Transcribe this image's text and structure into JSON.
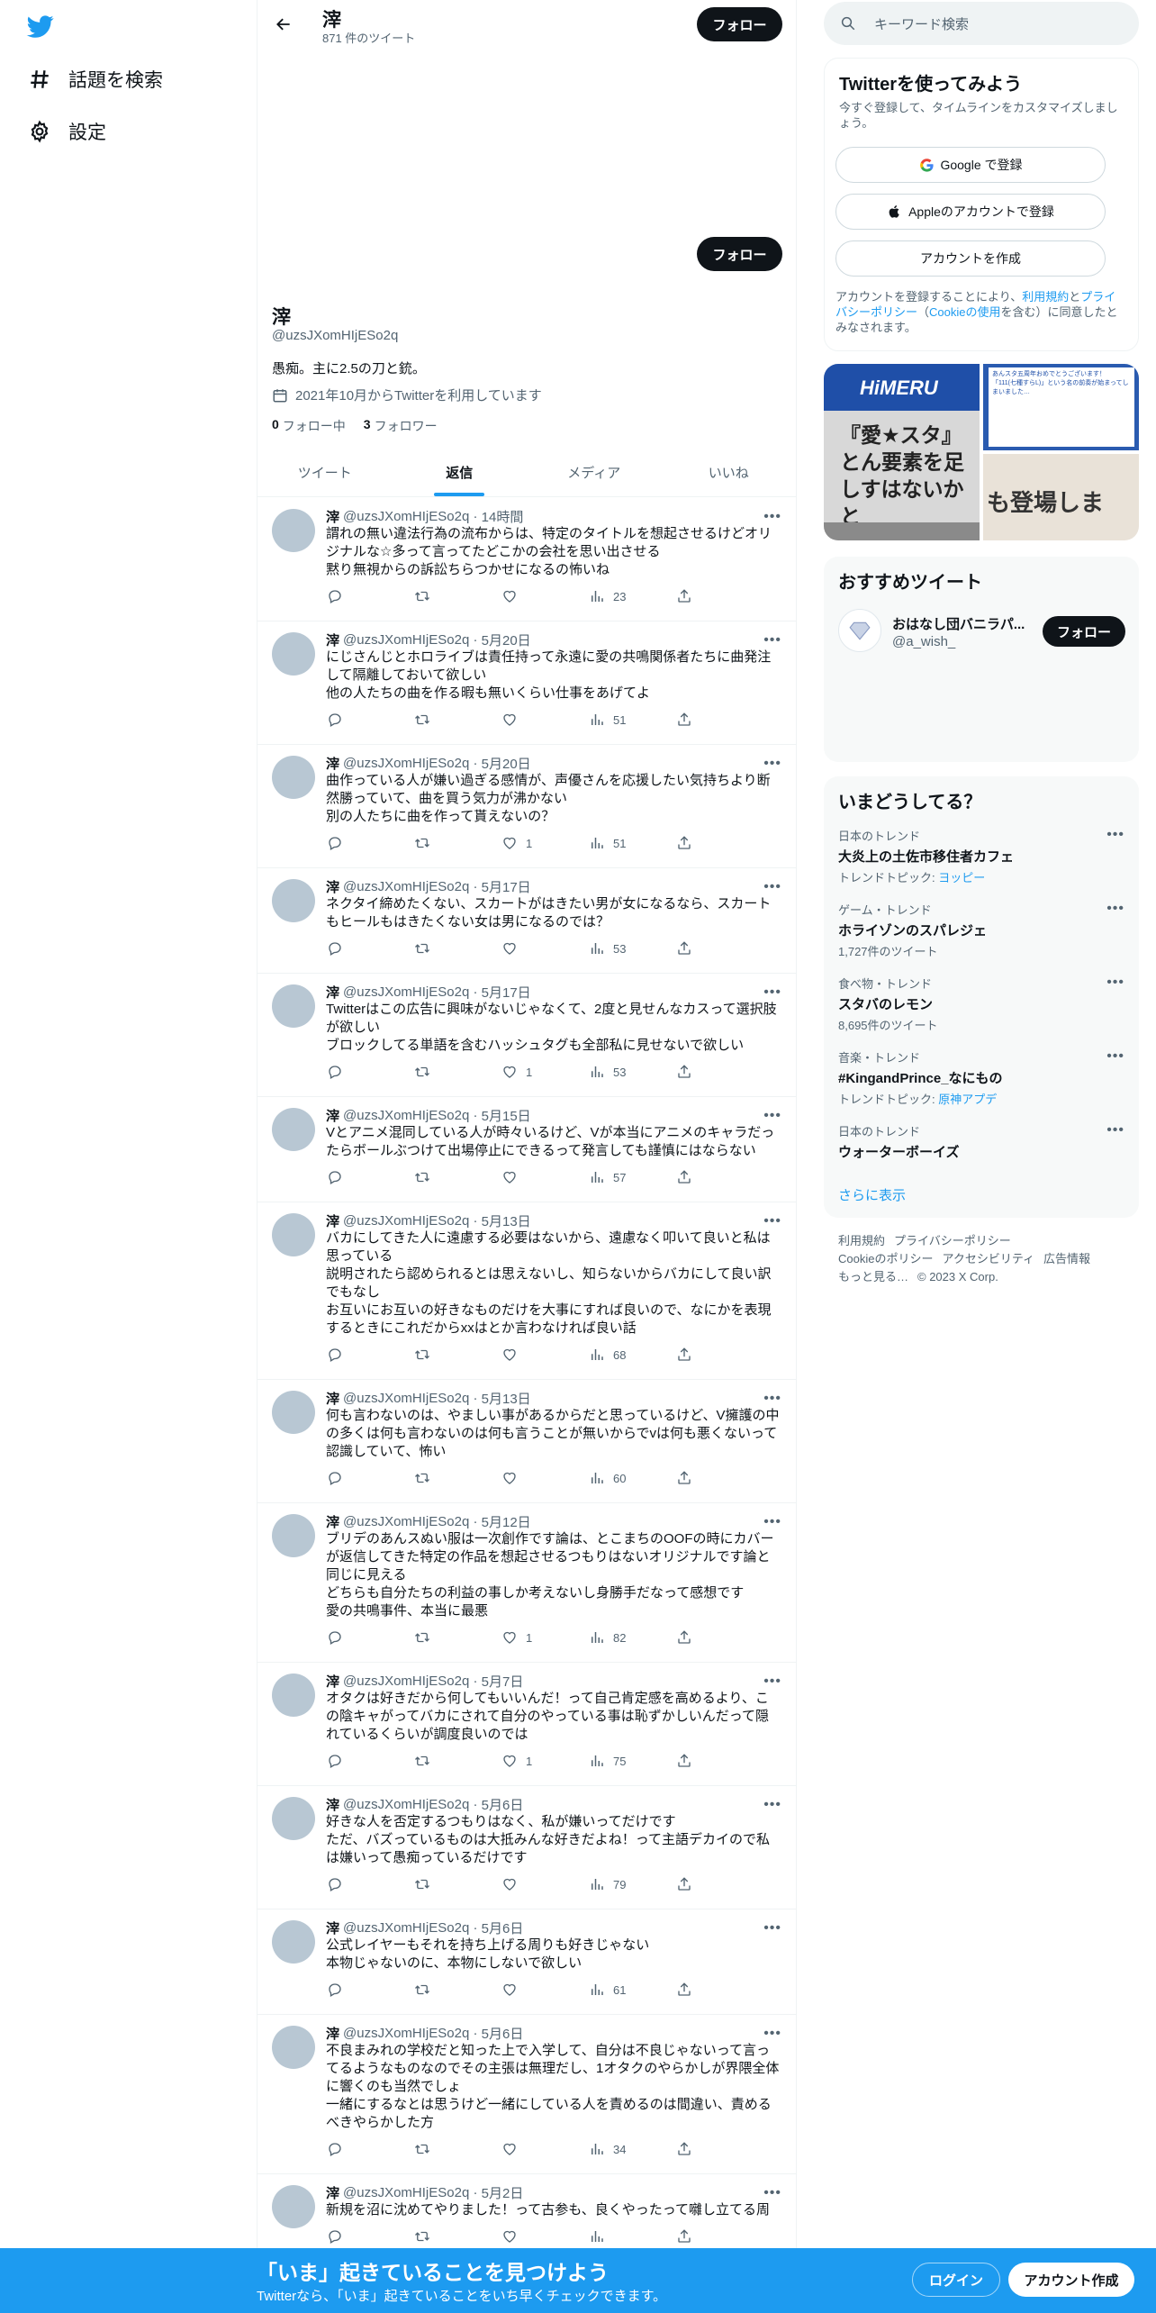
{
  "nav": {
    "logo": "twitter-bird",
    "items": [
      {
        "label": "話題を検索",
        "icon": "hash-icon"
      },
      {
        "label": "設定",
        "icon": "gear-icon"
      }
    ]
  },
  "header": {
    "name": "滓",
    "tweet_count": "871 件のツイート",
    "follow_label": "フォロー"
  },
  "profile": {
    "name": "滓",
    "handle": "@uzsJXomHIjESo2q",
    "bio": "愚痴。主に2.5の刀と銃。",
    "joined": "2021年10月からTwitterを利用しています",
    "following_count": "0",
    "following_label": "フォロー中",
    "followers_count": "3",
    "followers_label": "フォロワー",
    "follow_label": "フォロー"
  },
  "tabs": [
    {
      "label": "ツイート",
      "active": false
    },
    {
      "label": "返信",
      "active": true
    },
    {
      "label": "メディア",
      "active": false
    },
    {
      "label": "いいね",
      "active": false
    }
  ],
  "tweets": [
    {
      "name": "滓",
      "handle": "@uzsJXomHIjESo2q",
      "time": "14時間",
      "text": "謂れの無い違法行為の流布からは、特定のタイトルを想起させるけどオリジナルな☆多って言ってたどこかの会社を思い出させる\n黙り無視からの訴訟ちらつかせになるの怖いね",
      "likes": "",
      "views": "23"
    },
    {
      "name": "滓",
      "handle": "@uzsJXomHIjESo2q",
      "time": "5月20日",
      "text": "にじさんじとホロライブは責任持って永遠に愛の共鳴関係者たちに曲発注して隔離しておいて欲しい\n他の人たちの曲を作る暇も無いくらい仕事をあげてよ",
      "likes": "",
      "views": "51"
    },
    {
      "name": "滓",
      "handle": "@uzsJXomHIjESo2q",
      "time": "5月20日",
      "text": "曲作っている人が嫌い過ぎる感情が、声優さんを応援したい気持ちより断然勝っていて、曲を買う気力が沸かない\n別の人たちに曲を作って貰えないの？",
      "likes": "1",
      "views": "51"
    },
    {
      "name": "滓",
      "handle": "@uzsJXomHIjESo2q",
      "time": "5月17日",
      "text": "ネクタイ締めたくない、スカートがはきたい男が女になるなら、スカートもヒールもはきたくない女は男になるのでは？",
      "likes": "",
      "views": "53"
    },
    {
      "name": "滓",
      "handle": "@uzsJXomHIjESo2q",
      "time": "5月17日",
      "text": "Twitterはこの広告に興味がないじゃなくて、2度と見せんなカスって選択肢が欲しい\nブロックしてる単語を含むハッシュタグも全部私に見せないで欲しい",
      "likes": "1",
      "views": "53"
    },
    {
      "name": "滓",
      "handle": "@uzsJXomHIjESo2q",
      "time": "5月15日",
      "text": "Vとアニメ混同している人が時々いるけど、Vが本当にアニメのキャラだったらボールぶつけて出場停止にできるって発言しても謹慎にはならない",
      "likes": "",
      "views": "57"
    },
    {
      "name": "滓",
      "handle": "@uzsJXomHIjESo2q",
      "time": "5月13日",
      "text": "バカにしてきた人に遠慮する必要はないから、遠慮なく叩いて良いと私は思っている\n説明されたら認められるとは思えないし、知らないからバカにして良い訳でもなし\nお互いにお互いの好きなものだけを大事にすれば良いので、なにかを表現するときにこれだからxxはとか言わなければ良い話",
      "likes": "",
      "views": "68"
    },
    {
      "name": "滓",
      "handle": "@uzsJXomHIjESo2q",
      "time": "5月13日",
      "text": "何も言わないのは、やましい事があるからだと思っているけど、V擁護の中の多くは何も言わないのは何も言うことが無いからでvは何も悪くないって認識していて、怖い",
      "likes": "",
      "views": "60"
    },
    {
      "name": "滓",
      "handle": "@uzsJXomHIjESo2q",
      "time": "5月12日",
      "text": "ブリデのあんスぬい服は一次創作です論は、とこまちのOOFの時にカバーが返信してきた特定の作品を想起させるつもりはないオリジナルです論と同じに見える\nどちらも自分たちの利益の事しか考えないし身勝手だなって感想です\n愛の共鳴事件、本当に最悪",
      "likes": "1",
      "views": "82"
    },
    {
      "name": "滓",
      "handle": "@uzsJXomHIjESo2q",
      "time": "5月7日",
      "text": "オタクは好きだから何してもいいんだ！って自己肯定感を高めるより、この陰キャがってバカにされて自分のやっている事は恥ずかしいんだって隠れているくらいが調度良いのでは",
      "likes": "1",
      "views": "75"
    },
    {
      "name": "滓",
      "handle": "@uzsJXomHIjESo2q",
      "time": "5月6日",
      "text": "好きな人を否定するつもりはなく、私が嫌いってだけです\nただ、バズっているものは大抵みんな好きだよね！って主語デカイので私は嫌いって愚痴っているだけです",
      "likes": "",
      "views": "79"
    },
    {
      "name": "滓",
      "handle": "@uzsJXomHIjESo2q",
      "time": "5月6日",
      "text": "公式レイヤーもそれを持ち上げる周りも好きじゃない\n本物じゃないのに、本物にしないで欲しい",
      "likes": "",
      "views": "61"
    },
    {
      "name": "滓",
      "handle": "@uzsJXomHIjESo2q",
      "time": "5月6日",
      "text": "不良まみれの学校だと知った上で入学して、自分は不良じゃないって言ってるようなものなのでその主張は無理だし、1オタクのやらかしが界隈全体に響くのも当然でしょ\n一緒にするなとは思うけど一緒にしている人を責めるのは間違い、責めるべきやらかした方",
      "likes": "",
      "views": "34"
    },
    {
      "name": "滓",
      "handle": "@uzsJXomHIjESo2q",
      "time": "5月2日",
      "text": "新規を沼に沈めてやりました！って古参も、良くやったって囃し立てる周",
      "likes": "",
      "views": ""
    }
  ],
  "search": {
    "placeholder": "キーワード検索"
  },
  "signup": {
    "title": "Twitterを使ってみよう",
    "subtitle": "今すぐ登録して、タイムラインをカスタマイズしましょう。",
    "google_label": "Google で登録",
    "apple_label": "Appleのアカウントで登録",
    "create_label": "アカウントを作成",
    "legal_1": "アカウントを登録することにより、",
    "legal_terms": "利用規約",
    "legal_2": "と",
    "legal_privacy": "プライバシーポリシー",
    "legal_3": "（",
    "legal_cookie": "Cookieの使用",
    "legal_4": "を含む）に同意したとみなされます。"
  },
  "media": {
    "left_badge": "HiMERU",
    "left_text": "『愛★スタ』とん要素を足しすはないかと",
    "right_text": "あんスタ五周年おめでとうございます！\n「111(七種すらL)」という名の前奏が始まってしまいました…",
    "right_bottom_text": "も登場しま"
  },
  "recommend": {
    "title": "おすすめツイート",
    "name": "おはなし団バニラパ...",
    "handle": "@a_wish_",
    "follow_label": "フォロー"
  },
  "trends": {
    "title": "いまどうしてる？",
    "items": [
      {
        "category": "日本のトレンド",
        "name": "大炎上の土佐市移住者カフェ",
        "meta_prefix": "トレンドトピック: ",
        "meta_link": "ヨッピー",
        "meta": ""
      },
      {
        "category": "ゲーム・トレンド",
        "name": "ホライゾンのスパレジェ",
        "meta_prefix": "",
        "meta_link": "",
        "meta": "1,727件のツイート"
      },
      {
        "category": "食べ物・トレンド",
        "name": "スタバのレモン",
        "meta_prefix": "",
        "meta_link": "",
        "meta": "8,695件のツイート"
      },
      {
        "category": "音楽・トレンド",
        "name": "#KingandPrince_なにもの",
        "meta_prefix": "トレンドトピック: ",
        "meta_link": "原神アプデ",
        "meta": ""
      },
      {
        "category": "日本のトレンド",
        "name": "ウォーターボーイズ",
        "meta_prefix": "",
        "meta_link": "",
        "meta": ""
      }
    ],
    "show_more": "さらに表示"
  },
  "footer": [
    "利用規約",
    "プライバシーポリシー",
    "Cookieのポリシー",
    "アクセシビリティ",
    "広告情報",
    "もっと見る…",
    "© 2023 X Corp."
  ],
  "bottom": {
    "title": "「いま」起きていることを見つけよう",
    "subtitle": "Twitterなら、「いま」起きていることをいち早くチェックできます。",
    "login": "ログイン",
    "signup": "アカウント作成"
  },
  "colors": {
    "accent": "#1d9bf0",
    "dark": "#0f1419",
    "muted": "#536471"
  }
}
